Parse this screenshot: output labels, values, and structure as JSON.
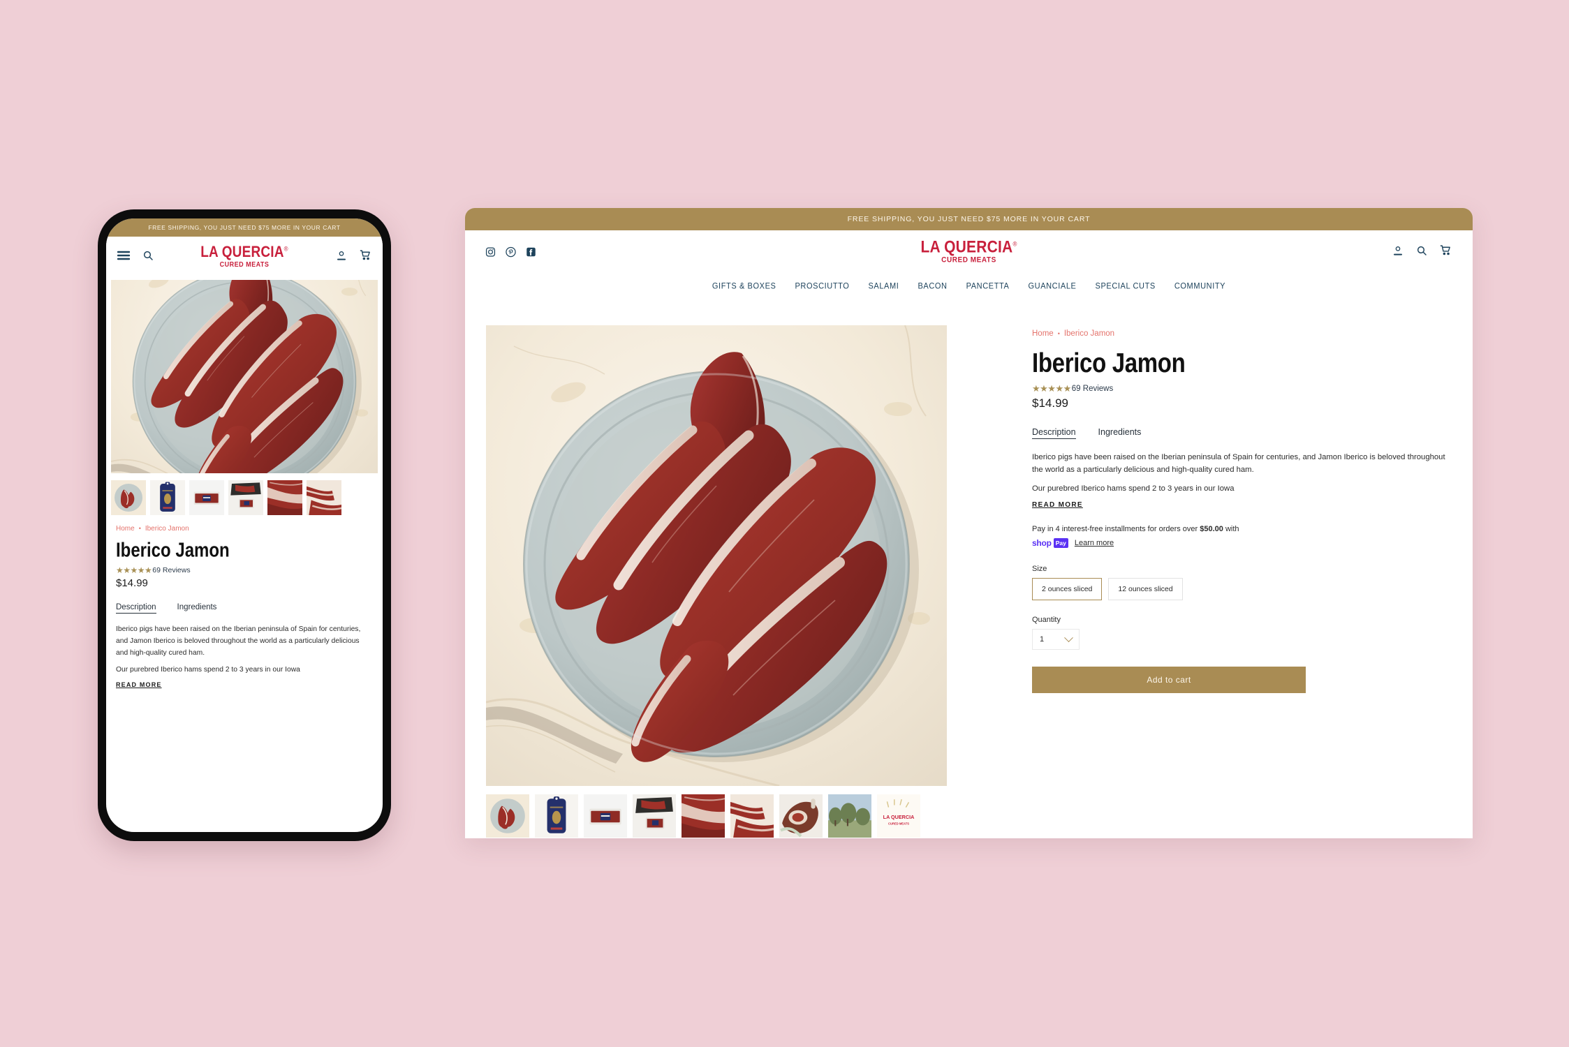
{
  "promo": {
    "text": "FREE SHIPPING, YOU JUST NEED $75 MORE IN YOUR CART"
  },
  "brand": {
    "name": "LA QUERCIA",
    "registered": "®",
    "tagline": "CURED MEATS",
    "color": "#c8203c"
  },
  "theme": {
    "page_background": "#efcfd6",
    "gold": "#a98c54",
    "nav_text": "#1e435c",
    "link_pink": "#e4736c",
    "star_gold": "#a89055",
    "shoppay_purple": "#5a31f4"
  },
  "social": [
    {
      "name": "instagram-icon",
      "label": "Instagram"
    },
    {
      "name": "pinterest-icon",
      "label": "Pinterest"
    },
    {
      "name": "facebook-icon",
      "label": "Facebook"
    }
  ],
  "header_icons": [
    {
      "name": "account-icon",
      "label": "Account"
    },
    {
      "name": "search-icon",
      "label": "Search"
    },
    {
      "name": "cart-icon",
      "label": "Cart"
    }
  ],
  "mobile_header_icons": {
    "menu": "Menu",
    "search": "Search",
    "account": "Account",
    "cart": "Cart"
  },
  "nav": [
    {
      "label": "GIFTS & BOXES"
    },
    {
      "label": "PROSCIUTTO"
    },
    {
      "label": "SALAMI"
    },
    {
      "label": "BACON"
    },
    {
      "label": "PANCETTA"
    },
    {
      "label": "GUANCIALE"
    },
    {
      "label": "SPECIAL CUTS"
    },
    {
      "label": "COMMUNITY"
    }
  ],
  "breadcrumb": {
    "home": "Home",
    "separator": "•",
    "current": "Iberico Jamon"
  },
  "product": {
    "title": "Iberico Jamon",
    "stars": "★★★★★",
    "rating_value": 4.5,
    "reviews_label": "69 Reviews",
    "price": "$14.99",
    "tabs": [
      {
        "label": "Description",
        "active": true
      },
      {
        "label": "Ingredients",
        "active": false
      }
    ],
    "description_p1": "Iberico pigs have been raised on the Iberian peninsula of Spain for centuries, and Jamon Iberico is beloved throughout the world as a particularly delicious and high-quality cured ham.",
    "description_p2": "Our purebred Iberico hams spend 2 to 3 years in our Iowa",
    "read_more": "READ MORE",
    "shoppay": {
      "text_before": "Pay in 4 interest-free installments for orders over ",
      "amount": "$50.00",
      "text_after": " with",
      "shop_word": "shop",
      "pay_word": "Pay",
      "learn_more": "Learn more"
    },
    "size": {
      "label": "Size",
      "options": [
        {
          "label": "2 ounces sliced",
          "selected": true
        },
        {
          "label": "12 ounces sliced",
          "selected": false
        }
      ]
    },
    "quantity": {
      "label": "Quantity",
      "value": "1"
    },
    "add_to_cart": "Add to cart"
  },
  "gallery": {
    "hero_alt": "Sliced Iberico jamon fanned on a grey ceramic plate on marble",
    "desktop_thumbs": [
      {
        "name": "thumb-plate"
      },
      {
        "name": "thumb-package-navy"
      },
      {
        "name": "thumb-package-white"
      },
      {
        "name": "thumb-slices-board"
      },
      {
        "name": "thumb-closeup-slices"
      },
      {
        "name": "thumb-folded-slices"
      },
      {
        "name": "thumb-ham-leg"
      },
      {
        "name": "thumb-field"
      },
      {
        "name": "thumb-logo-card"
      }
    ],
    "mobile_thumbs": [
      {
        "name": "thumb-plate"
      },
      {
        "name": "thumb-package-navy"
      },
      {
        "name": "thumb-package-white"
      },
      {
        "name": "thumb-package-small"
      },
      {
        "name": "thumb-closeup-slices"
      },
      {
        "name": "thumb-folded-slices"
      }
    ]
  }
}
